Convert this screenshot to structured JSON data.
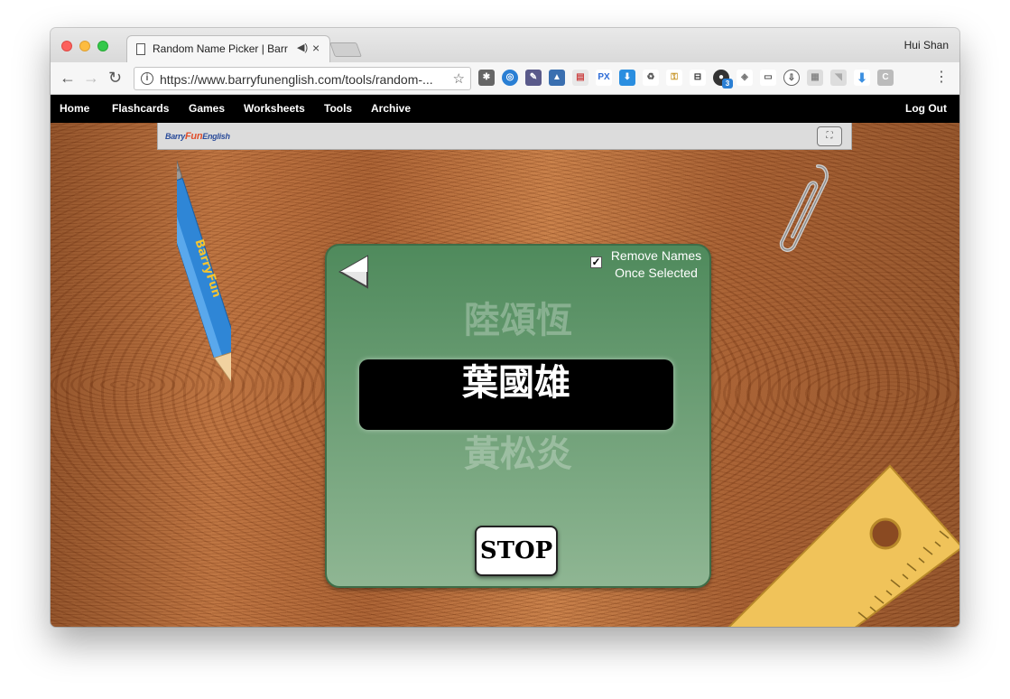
{
  "browser": {
    "tab_title": "Random Name Picker | Barr",
    "profile_name": "Hui Shan",
    "url": "https://www.barryfunenglish.com/tools/random-...",
    "extension_badge": "3"
  },
  "site_nav": {
    "items": [
      "Home",
      "Flashcards",
      "Games",
      "Worksheets",
      "Tools",
      "Archive"
    ],
    "logout": "Log Out"
  },
  "banner": {
    "logo_part1": "Barry",
    "logo_part2": "Fun",
    "logo_part3": "English"
  },
  "pencil_label": "BarryFun",
  "picker": {
    "remove_names_label_line1": "Remove Names",
    "remove_names_label_line2": "Once Selected",
    "remove_names_checked": true,
    "checkmark": "✓",
    "previous_name": "陸頌恆",
    "current_name": "葉國雄",
    "next_name": "黃松炎",
    "stop_label": "STOP"
  },
  "colors": {
    "panel_green": "#5a8f64",
    "nav_black": "#000000",
    "wood": "#b06a38"
  }
}
